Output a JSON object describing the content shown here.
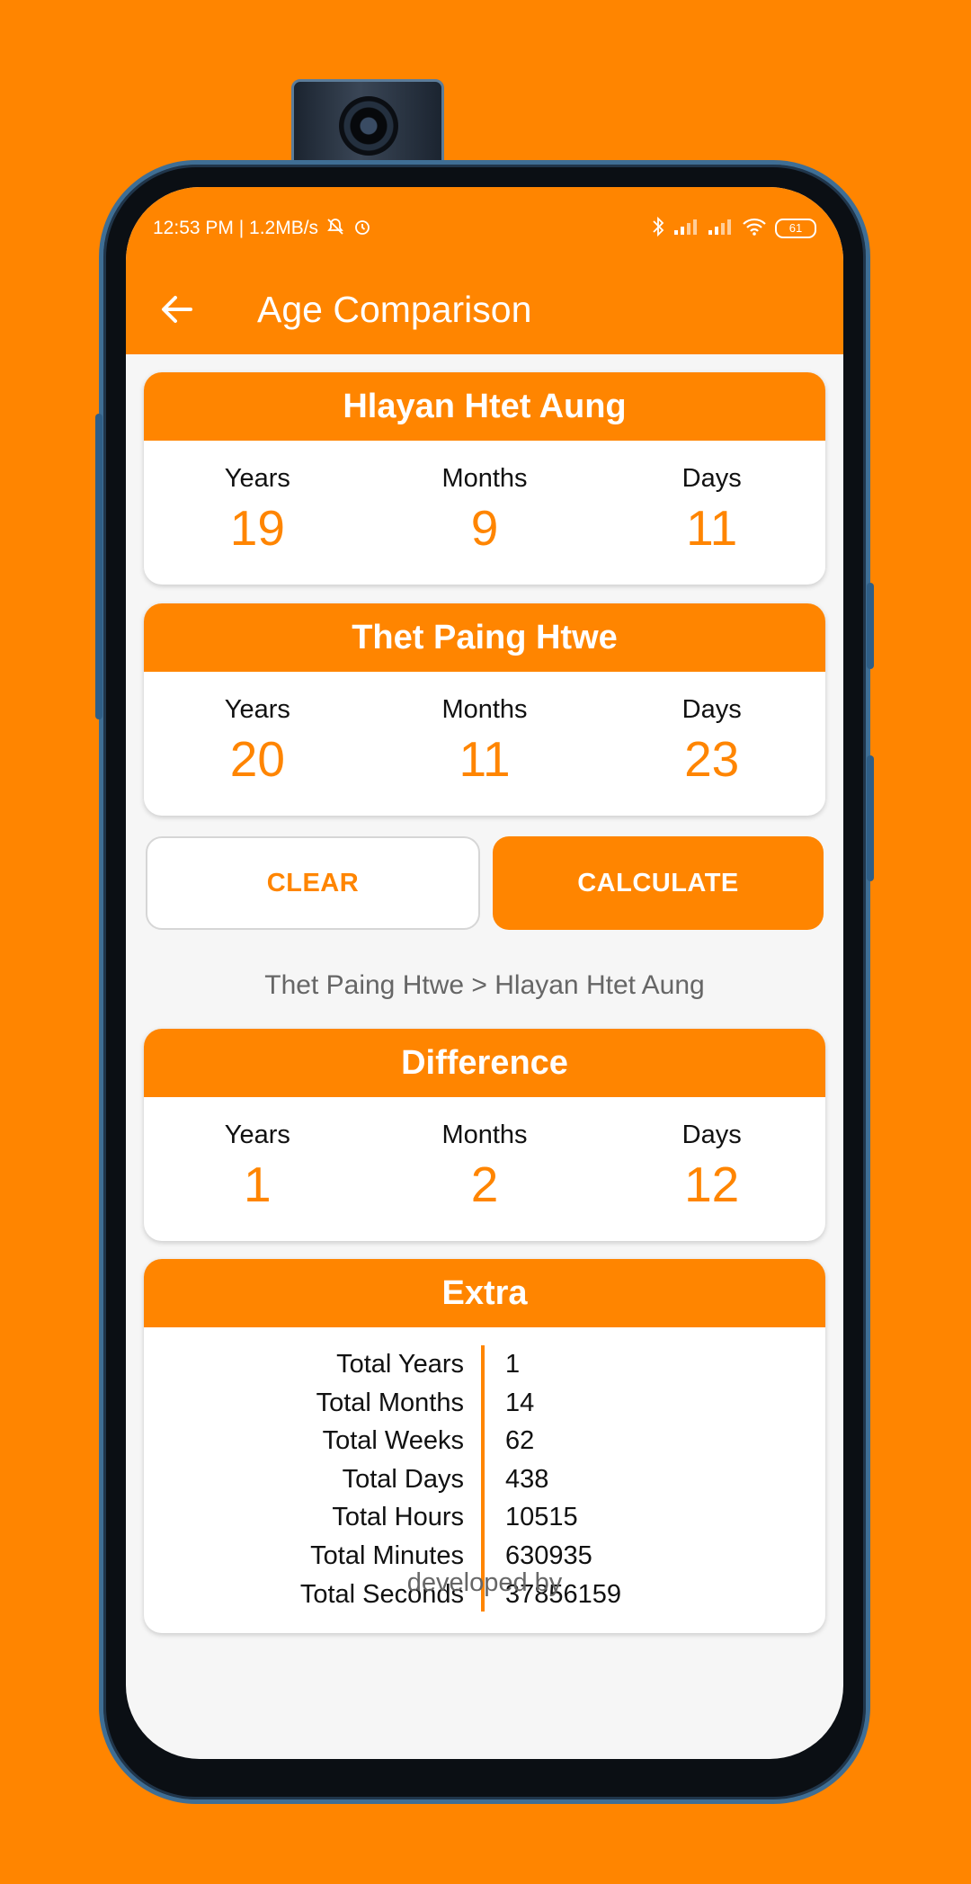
{
  "status_bar": {
    "time_speed": "12:53 PM | 1.2MB/s",
    "battery": "61"
  },
  "toolbar": {
    "title": "Age Comparison",
    "back_icon": "arrow-left-icon"
  },
  "person1": {
    "name": "Hlayan Htet Aung",
    "years_label": "Years",
    "months_label": "Months",
    "days_label": "Days",
    "years": "19",
    "months": "9",
    "days": "11"
  },
  "person2": {
    "name": "Thet Paing Htwe",
    "years_label": "Years",
    "months_label": "Months",
    "days_label": "Days",
    "years": "20",
    "months": "11",
    "days": "23"
  },
  "actions": {
    "clear_label": "CLEAR",
    "calculate_label": "CALCULATE"
  },
  "comparison": "Thet Paing Htwe > Hlayan Htet Aung",
  "difference": {
    "title": "Difference",
    "years_label": "Years",
    "months_label": "Months",
    "days_label": "Days",
    "years": "1",
    "months": "2",
    "days": "12"
  },
  "extra": {
    "title": "Extra",
    "rows": [
      {
        "label": "Total Years",
        "value": "1"
      },
      {
        "label": "Total Months",
        "value": "14"
      },
      {
        "label": "Total Weeks",
        "value": "62"
      },
      {
        "label": "Total Days",
        "value": "438"
      },
      {
        "label": "Total Hours",
        "value": "10515"
      },
      {
        "label": "Total Minutes",
        "value": "630935"
      },
      {
        "label": "Total Seconds",
        "value": "37856159"
      }
    ]
  },
  "footer": {
    "developed_by": "developed by"
  },
  "colors": {
    "accent": "#FF8500",
    "background": "#f6f6f6"
  }
}
